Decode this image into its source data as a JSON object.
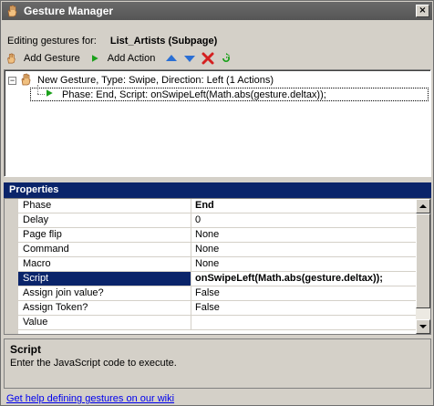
{
  "window": {
    "title": "Gesture Manager",
    "close_glyph": "×"
  },
  "editing": {
    "label": "Editing gestures for:",
    "target": "List_Artists (Subpage)"
  },
  "toolbar": {
    "add_gesture_label": "Add Gesture",
    "add_action_label": "Add Action",
    "icons": [
      "hand-icon",
      "play-icon",
      "move-up-icon",
      "move-down-icon",
      "delete-icon",
      "refresh-icon"
    ]
  },
  "tree": {
    "expander": "−",
    "gesture": "New Gesture, Type: Swipe, Direction: Left (1 Actions)",
    "action": "Phase: End, Script: onSwipeLeft(Math.abs(gesture.deltax));"
  },
  "properties": {
    "header": "Properties",
    "rows": [
      {
        "name": "Phase",
        "value": "End"
      },
      {
        "name": "Delay",
        "value": "0"
      },
      {
        "name": "Page flip",
        "value": "None"
      },
      {
        "name": "Command",
        "value": "None"
      },
      {
        "name": "Macro",
        "value": "None"
      },
      {
        "name": "Script",
        "value": "onSwipeLeft(Math.abs(gesture.deltax));"
      },
      {
        "name": "Assign join value?",
        "value": "False"
      },
      {
        "name": "Assign Token?",
        "value": "False"
      },
      {
        "name": "Value",
        "value": ""
      }
    ]
  },
  "description": {
    "title": "Script",
    "text": "Enter the JavaScript code to execute."
  },
  "help_link": "Get help defining gestures on our wiki",
  "colors": {
    "title_bar": "#5f5f5f",
    "selection": "#0a246a",
    "link": "#0000ee",
    "delete_red": "#d42020",
    "play_green": "#1aa01a",
    "arrow_blue": "#2a6fd4"
  }
}
